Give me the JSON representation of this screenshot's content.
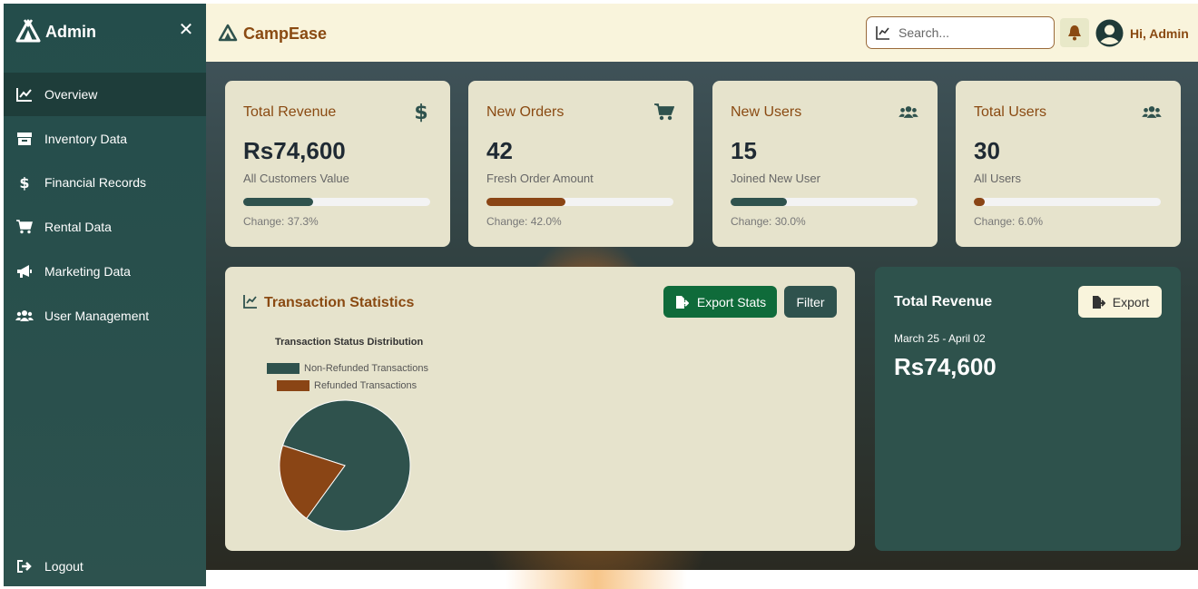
{
  "sidebar": {
    "title": "Admin",
    "close_symbol": "✕",
    "items": [
      {
        "label": "Overview",
        "icon": "chart-line-icon",
        "active": true
      },
      {
        "label": "Inventory Data",
        "icon": "box-icon",
        "active": false
      },
      {
        "label": "Financial Records",
        "icon": "dollar-icon",
        "active": false
      },
      {
        "label": "Rental Data",
        "icon": "cart-icon",
        "active": false
      },
      {
        "label": "Marketing Data",
        "icon": "megaphone-icon",
        "active": false
      },
      {
        "label": "User Management",
        "icon": "users-icon",
        "active": false
      }
    ],
    "logout_label": "Logout"
  },
  "topbar": {
    "brand": "CampEase",
    "search_placeholder": "Search...",
    "greeting": "Hi, Admin"
  },
  "cards": [
    {
      "title": "Total Revenue",
      "icon": "dollar-icon",
      "value": "Rs74,600",
      "subtitle": "All Customers Value",
      "progress": 0.373,
      "progress_color": "#2f524d",
      "change": "Change: 37.3%"
    },
    {
      "title": "New Orders",
      "icon": "cart-icon",
      "value": "42",
      "subtitle": "Fresh Order Amount",
      "progress": 0.42,
      "progress_color": "#8a4515",
      "change": "Change: 42.0%"
    },
    {
      "title": "New Users",
      "icon": "users-icon",
      "value": "15",
      "subtitle": "Joined New User",
      "progress": 0.3,
      "progress_color": "#2f524d",
      "change": "Change: 30.0%"
    },
    {
      "title": "Total Users",
      "icon": "users-icon",
      "value": "30",
      "subtitle": "All Users",
      "progress": 0.06,
      "progress_color": "#8a4515",
      "change": "Change: 6.0%"
    }
  ],
  "stats": {
    "title": "Transaction Statistics",
    "export_label": "Export Stats",
    "filter_label": "Filter"
  },
  "revenue_panel": {
    "title": "Total Revenue",
    "export_label": "Export",
    "date_range": "March 25 - April 02",
    "value": "Rs74,600"
  },
  "chart_data": {
    "type": "pie",
    "title": "Transaction Status Distribution",
    "legend_placement": "top",
    "series": [
      {
        "name": "Non-Refunded Transactions",
        "value": 0.8,
        "color": "#2f524d"
      },
      {
        "name": "Refunded Transactions",
        "value": 0.2,
        "color": "#8a4515"
      }
    ]
  },
  "colors": {
    "accent_brown": "#8a4a12",
    "dark_teal": "#2f524d",
    "export_green": "#0f6b3a",
    "card_bg": "#e6e3cc"
  }
}
